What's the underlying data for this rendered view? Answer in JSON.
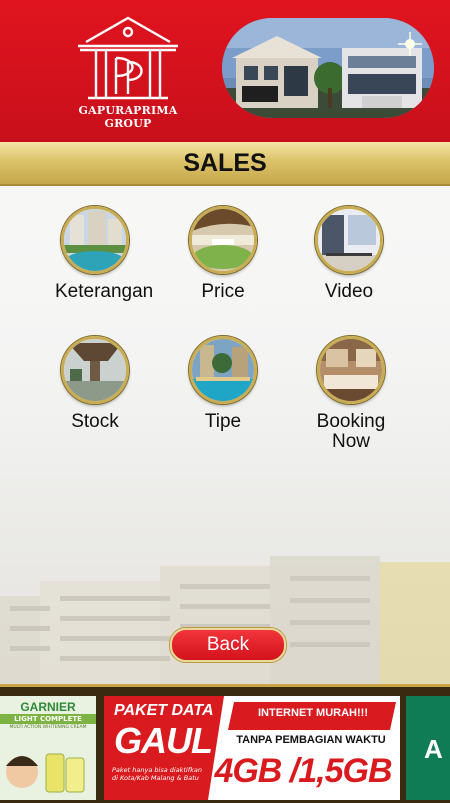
{
  "header": {
    "brand": "GAPURAPRIMA GROUP"
  },
  "page": {
    "title": "SALES"
  },
  "menu": [
    {
      "label": "Keterangan"
    },
    {
      "label": "Price"
    },
    {
      "label": "Video"
    },
    {
      "label": "Stock"
    },
    {
      "label": "Tipe"
    },
    {
      "label": "Booking Now"
    }
  ],
  "back": {
    "label": "Back"
  },
  "ads": {
    "garnier": {
      "brand": "GARNIER",
      "line": "LIGHT COMPLETE",
      "sub": "MULTI ACTION WHITENING CREAM"
    },
    "paket": {
      "title1": "PAKET DATA",
      "title2": "GAUL",
      "note": "Paket hanya bisa diaktifkan di Kota/Kab Malang & Batu",
      "promo": "INTERNET MURAH!!!",
      "promo2": "TANPA PEMBAGIAN WAKTU",
      "quota": "4GB /1,5GB"
    },
    "right": {
      "letter": "A"
    }
  },
  "colors": {
    "brand_red": "#d3121b",
    "gold": "#c9ad55"
  }
}
